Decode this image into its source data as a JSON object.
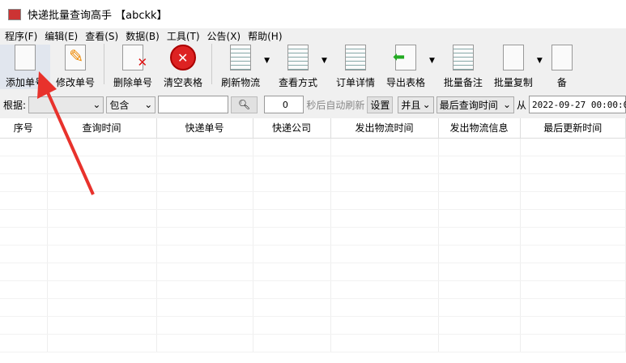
{
  "title": "快递批量查询高手 【abckk】",
  "menu": [
    "程序(F)",
    "编辑(E)",
    "查看(S)",
    "数据(B)",
    "工具(T)",
    "公告(X)",
    "帮助(H)"
  ],
  "toolbar": {
    "add": "添加单号",
    "edit": "修改单号",
    "delete": "删除单号",
    "clear": "清空表格",
    "refresh": "刷新物流",
    "view": "查看方式",
    "detail": "订单详情",
    "export": "导出表格",
    "note": "批量备注",
    "copy": "批量复制",
    "more": "备"
  },
  "filter": {
    "label": "根据:",
    "field": "",
    "match": "包含",
    "keyword": "",
    "seconds": "0",
    "auto_refresh": "秒后自动刷新",
    "set": "设置",
    "logic": "并且",
    "time_field": "最后查询时间",
    "from": "从",
    "date": "2022-09-27 00:00:00"
  },
  "columns": [
    "序号",
    "查询时间",
    "快递单号",
    "快递公司",
    "发出物流时间",
    "发出物流信息",
    "最后更新时间"
  ]
}
